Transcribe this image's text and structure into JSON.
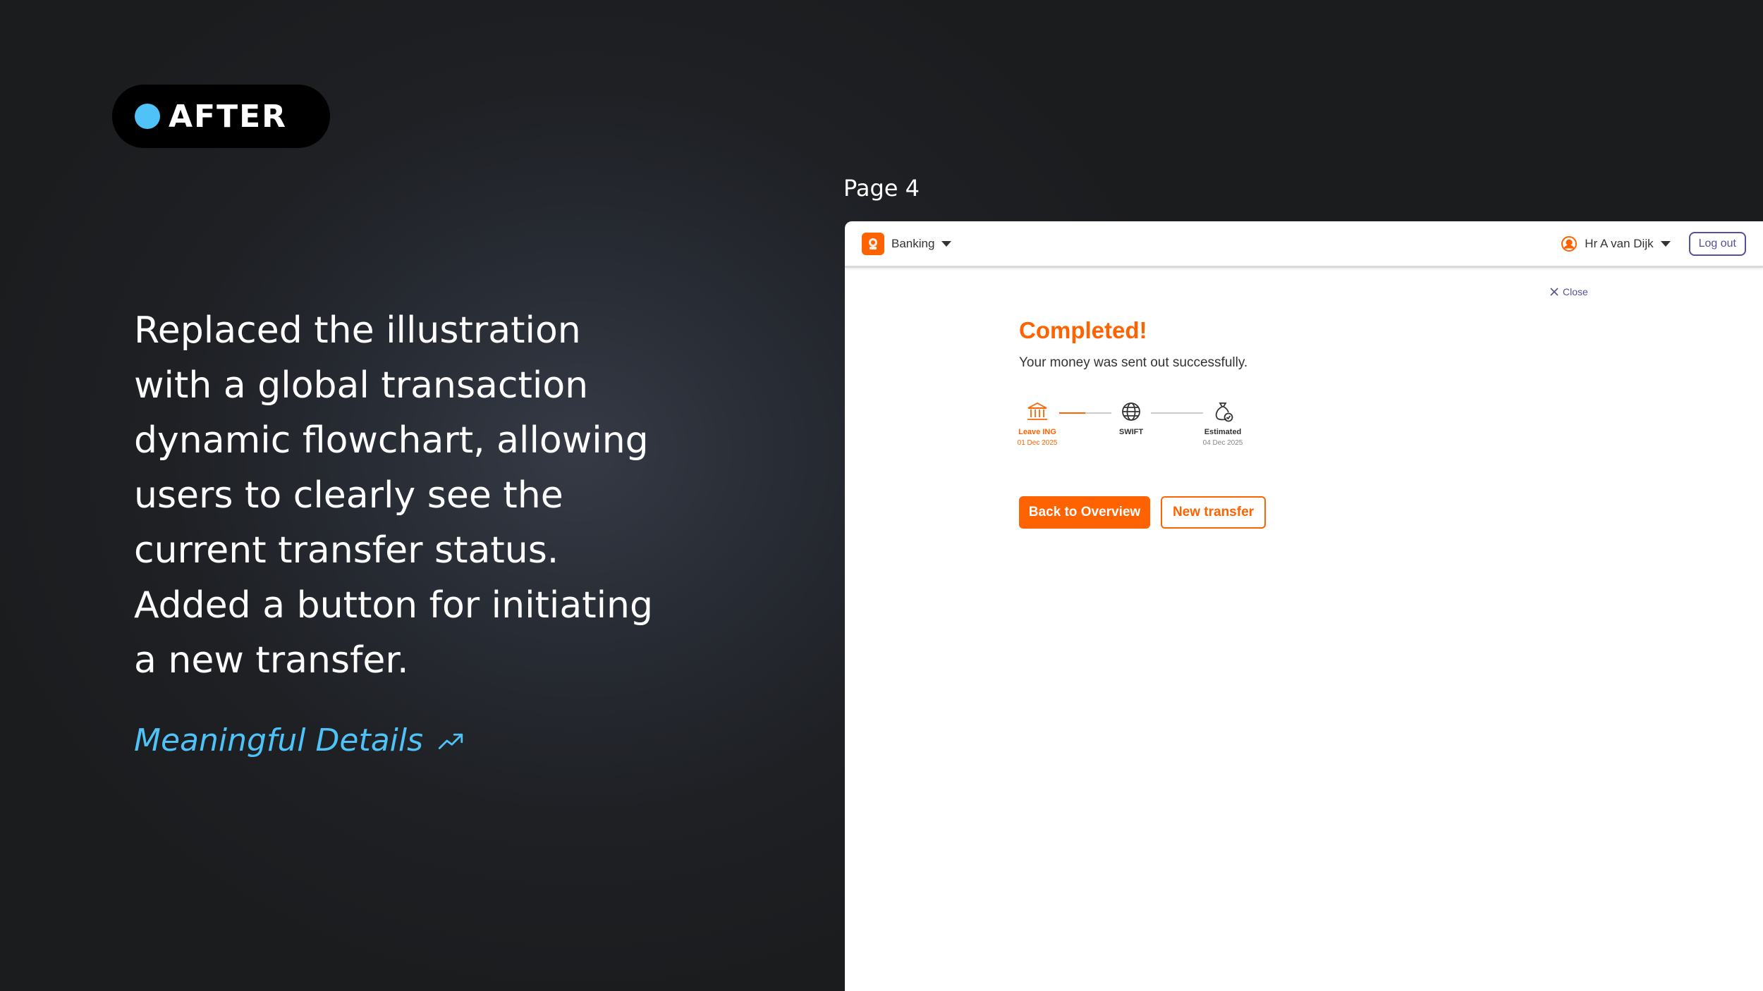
{
  "badge": {
    "label": "AFTER",
    "dot_color": "#4fc3f7"
  },
  "description": "Replaced the illustration with a global transaction dynamic flowchart, allowing users to clearly see the current transfer status. Added a  button for initiating a new transfer.",
  "details_link": {
    "label": "Meaningful Details",
    "icon": "trending-up-icon"
  },
  "page_label": "Page 4",
  "app": {
    "product": "Banking",
    "user_name": "Hr A van Dijk",
    "logout_label": "Log out",
    "close_label": "Close",
    "title": "Completed!",
    "subtitle": "Your money was sent out successfully.",
    "steps": [
      {
        "label": "Leave ING",
        "date": "01 Dec 2025",
        "icon": "bank-icon",
        "active": true
      },
      {
        "label": "SWIFT",
        "date": "",
        "icon": "globe-icon",
        "active": false
      },
      {
        "label": "Estimated",
        "date": "04 Dec 2025",
        "icon": "money-bag-icon",
        "active": false
      }
    ],
    "progress_first_segment": 0.5,
    "primary_button": "Back to Overview",
    "secondary_button": "New transfer",
    "accent_color": "#ff6200",
    "link_color": "#525199"
  }
}
